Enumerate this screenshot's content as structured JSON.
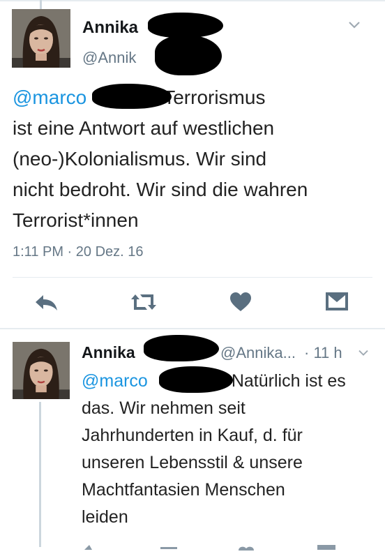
{
  "tweet": {
    "author_name": "Annika",
    "author_handle": "@Annik",
    "mention": "@marco",
    "text_line1": "Terrorismus",
    "text_line2": "ist eine Antwort auf westlichen",
    "text_line3": "(neo-)Kolonialismus. Wir sind",
    "text_line4": "nicht bedroht. Wir sind die wahren",
    "text_line5": "Terrorist*innen",
    "timestamp": "1:11 PM · 20 Dez. 16",
    "actions": {
      "reply_icon": "reply-icon",
      "retweet_icon": "retweet-icon",
      "like_icon": "heart-icon",
      "dm_icon": "envelope-icon"
    }
  },
  "reply": {
    "author_name": "Annika",
    "author_handle": "@Annika...",
    "time": "· 11 h",
    "mention": "@marco",
    "text_line1": "Natürlich ist es",
    "text_line2": "das. Wir nehmen seit",
    "text_line3": "Jahrhunderten in Kauf, d. für",
    "text_line4": "unseren Lebensstil & unsere",
    "text_line5": "Machtfantasien Menschen",
    "text_line6": "leiden"
  },
  "colors": {
    "mention": "#1b95e0",
    "secondary": "#657786",
    "icon": "#5a6f80",
    "divider": "#e6ecf0"
  }
}
